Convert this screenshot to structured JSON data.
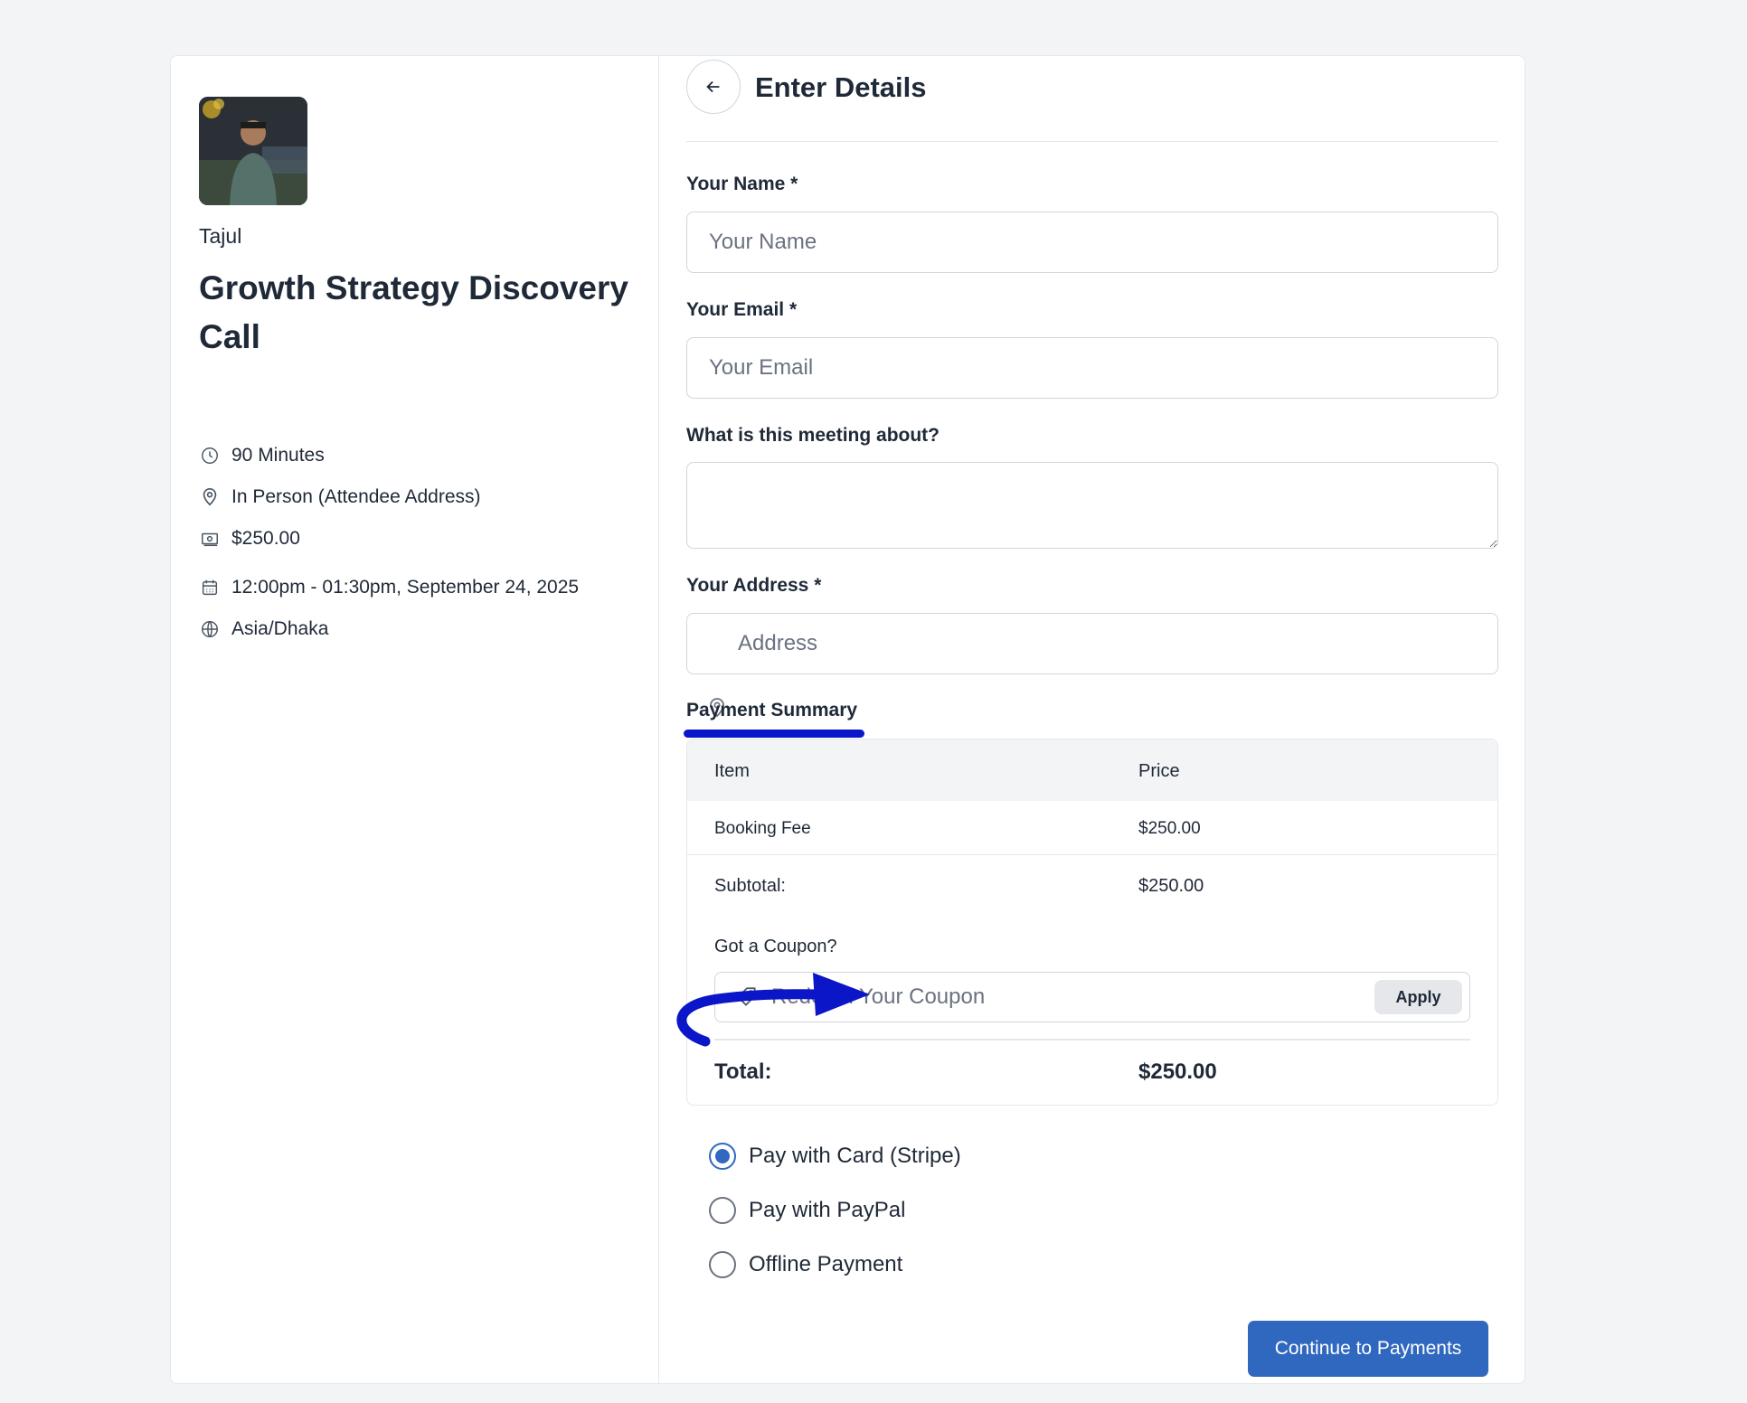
{
  "host": {
    "name": "Tajul"
  },
  "event": {
    "title": "Growth Strategy Discovery Call",
    "duration": "90 Minutes",
    "location": "In Person (Attendee Address)",
    "price": "$250.00",
    "datetime": "12:00pm - 01:30pm, September 24, 2025",
    "timezone": "Asia/Dhaka"
  },
  "form": {
    "title": "Enter Details",
    "name_label": "Your Name *",
    "name_placeholder": "Your Name",
    "email_label": "Your Email *",
    "email_placeholder": "Your Email",
    "about_label": "What is this meeting about?",
    "address_label": "Your Address *",
    "address_placeholder": "Address"
  },
  "payment_summary": {
    "heading": "Payment Summary",
    "columns": [
      "Item",
      "Price"
    ],
    "rows": [
      {
        "item": "Booking Fee",
        "price": "$250.00"
      }
    ],
    "subtotal_label": "Subtotal:",
    "subtotal_value": "$250.00",
    "coupon_label": "Got a Coupon?",
    "coupon_placeholder": "Redeem Your Coupon",
    "apply_label": "Apply",
    "total_label": "Total:",
    "total_value": "$250.00"
  },
  "payment_methods": [
    {
      "label": "Pay with Card (Stripe)",
      "selected": true
    },
    {
      "label": "Pay with PayPal",
      "selected": false
    },
    {
      "label": "Offline Payment",
      "selected": false
    }
  ],
  "continue_label": "Continue to Payments",
  "colors": {
    "primary": "#3068c0",
    "annotation": "#0a16c8"
  }
}
